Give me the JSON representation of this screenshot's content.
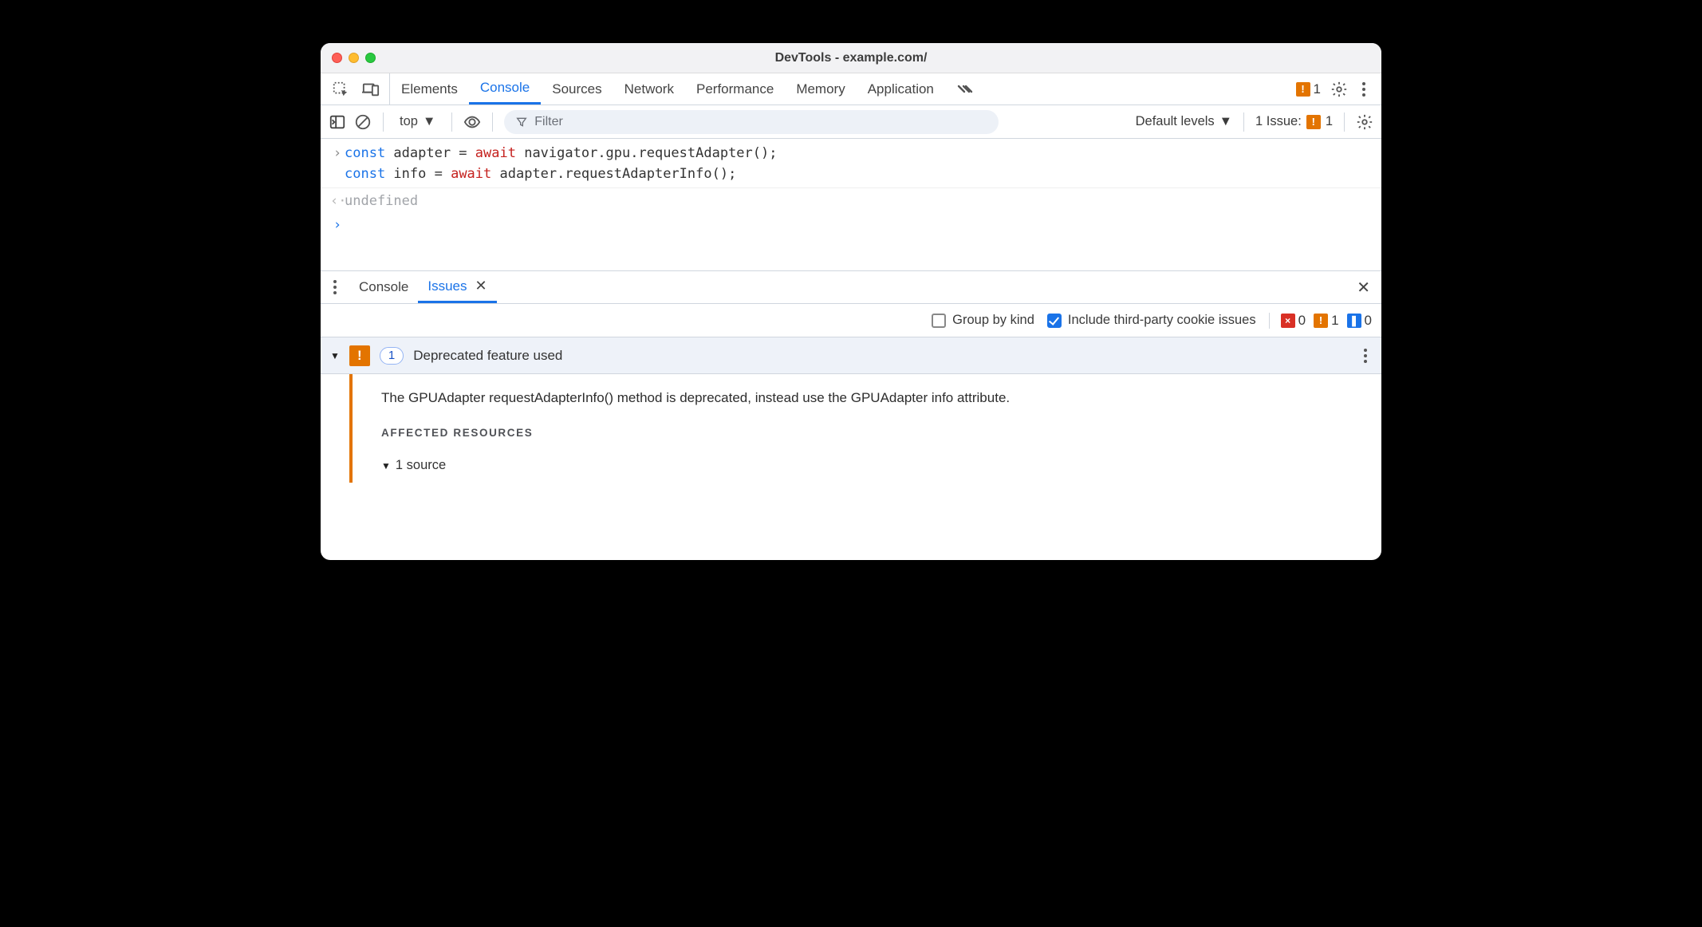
{
  "window": {
    "title": "DevTools - example.com/"
  },
  "tabs": {
    "items": [
      "Elements",
      "Console",
      "Sources",
      "Network",
      "Performance",
      "Memory",
      "Application"
    ],
    "active": "Console",
    "warn_count": "1"
  },
  "filterbar": {
    "context": "top",
    "filter_placeholder": "Filter",
    "levels": "Default levels",
    "issue_label": "1 Issue:",
    "issue_count": "1"
  },
  "console": {
    "line1_a": "const",
    "line1_b": " adapter = ",
    "line1_c": "await",
    "line1_d": " navigator.gpu.requestAdapter();",
    "line2_a": "const",
    "line2_b": " info = ",
    "line2_c": "await",
    "line2_d": " adapter.requestAdapterInfo();",
    "return": "undefined"
  },
  "drawer": {
    "tabs": {
      "console": "Console",
      "issues": "Issues"
    }
  },
  "issues_tb": {
    "group": "Group by kind",
    "third": "Include third-party cookie issues",
    "err": "0",
    "warn": "1",
    "info": "0"
  },
  "issue": {
    "count": "1",
    "title": "Deprecated feature used",
    "message": "The GPUAdapter requestAdapterInfo() method is deprecated, instead use the GPUAdapter info attribute.",
    "affected": "AFFECTED RESOURCES",
    "sources": "1 source"
  }
}
